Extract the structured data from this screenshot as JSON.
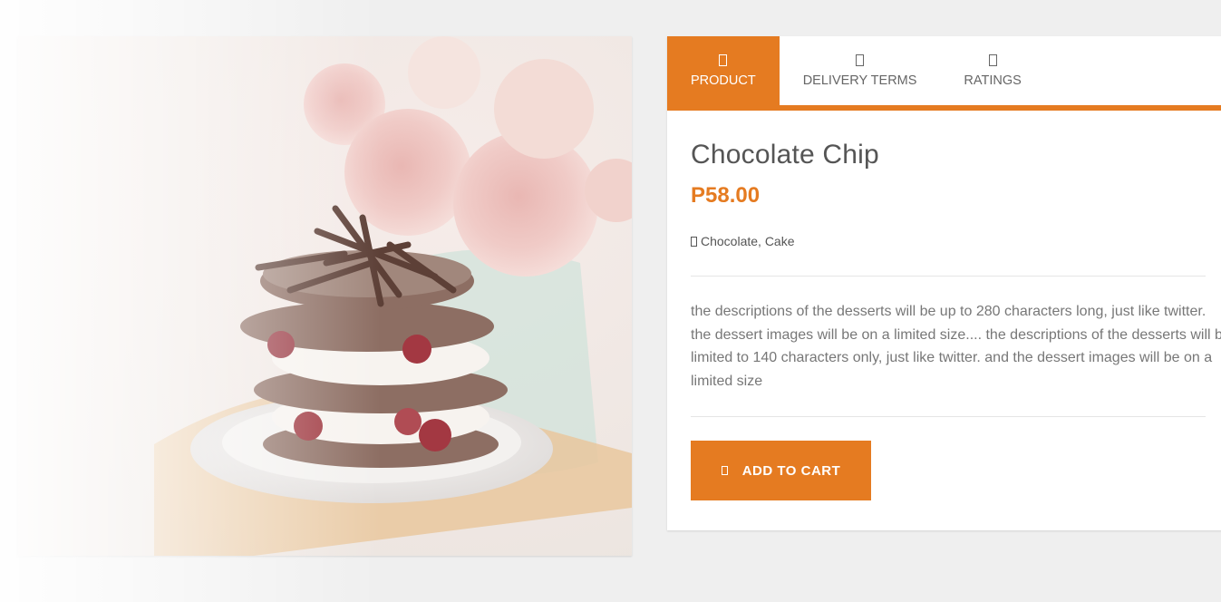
{
  "colors": {
    "accent": "#e57b21",
    "title_text": "#555555",
    "body_text": "#777777",
    "background": "#efefef"
  },
  "product_image": {
    "icon": "dessert-photo"
  },
  "tabs": [
    {
      "label": "PRODUCT",
      "icon": "product-icon",
      "active": true
    },
    {
      "label": "DELIVERY TERMS",
      "icon": "truck-icon",
      "active": false
    },
    {
      "label": "RATINGS",
      "icon": "star-icon",
      "active": false
    }
  ],
  "product": {
    "title": "Chocolate Chip",
    "price": "P58.00",
    "tags_icon": "tag-icon",
    "tags": "Chocolate, Cake",
    "description_lines": [
      "the descriptions of the desserts will be up to 280 characters long, just like twitter.",
      "the dessert images will be on a limited size.... the descriptions of the desserts will be",
      "limited to 140 characters only, just like twitter. and the dessert images will be on a",
      "limited size"
    ]
  },
  "cart_button": {
    "icon": "cart-icon",
    "label": "ADD TO CART"
  }
}
